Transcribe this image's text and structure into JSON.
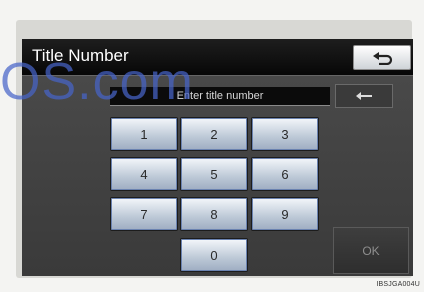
{
  "header": {
    "title": "Title Number",
    "back_icon": "return-arrow-icon"
  },
  "entry": {
    "placeholder": "Enter title number"
  },
  "delete_button": {
    "icon": "backspace-arrow-icon"
  },
  "keypad": {
    "keys": [
      "1",
      "2",
      "3",
      "4",
      "5",
      "6",
      "7",
      "8",
      "9",
      "0"
    ]
  },
  "ok_button": {
    "label": "OK"
  },
  "watermark": {
    "text": "OS.com"
  },
  "figure_code": {
    "text": "IBSJGA004U"
  }
}
